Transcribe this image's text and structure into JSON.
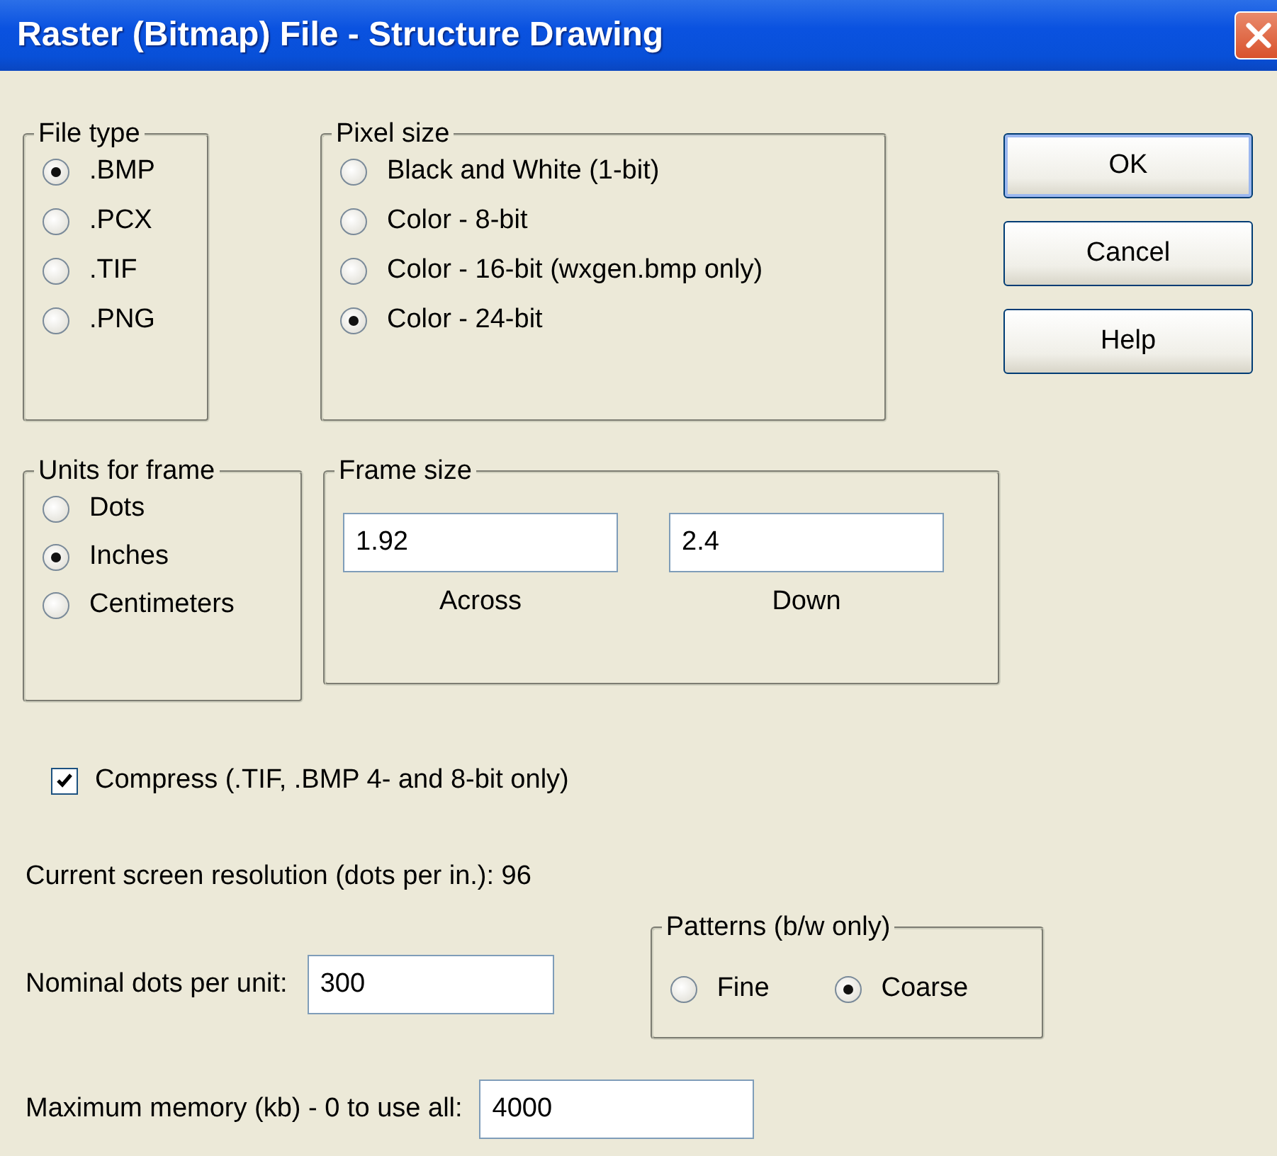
{
  "window": {
    "title": "Raster (Bitmap) File - Structure Drawing"
  },
  "file_type": {
    "label": "File type",
    "options": [
      {
        "label": ".BMP",
        "selected": true
      },
      {
        "label": ".PCX",
        "selected": false
      },
      {
        "label": ".TIF",
        "selected": false
      },
      {
        "label": ".PNG",
        "selected": false
      }
    ]
  },
  "pixel_size": {
    "label": "Pixel size",
    "options": [
      {
        "label": "Black and White (1-bit)",
        "selected": false
      },
      {
        "label": "Color - 8-bit",
        "selected": false
      },
      {
        "label": "Color - 16-bit (wxgen.bmp only)",
        "selected": false
      },
      {
        "label": "Color - 24-bit",
        "selected": true
      }
    ]
  },
  "buttons": [
    {
      "label": "OK",
      "default": true
    },
    {
      "label": "Cancel",
      "default": false
    },
    {
      "label": "Help",
      "default": false
    }
  ],
  "units_for_frame": {
    "label": "Units for frame",
    "options": [
      {
        "label": "Dots",
        "selected": false
      },
      {
        "label": "Inches",
        "selected": true
      },
      {
        "label": "Centimeters",
        "selected": false
      }
    ]
  },
  "frame_size": {
    "label": "Frame size",
    "fields": [
      {
        "value": "1.92",
        "caption": "Across"
      },
      {
        "value": "2.4",
        "caption": "Down"
      }
    ]
  },
  "compress": {
    "label": "Compress (.TIF, .BMP 4- and 8-bit only)",
    "checked": true
  },
  "resolution": "Current screen resolution (dots per in.): 96",
  "nominal": {
    "label": "Nominal dots per unit:",
    "value": "300"
  },
  "patterns": {
    "label": "Patterns (b/w only)",
    "options": [
      {
        "label": "Fine",
        "selected": false
      },
      {
        "label": "Coarse",
        "selected": true
      }
    ]
  },
  "memory": {
    "label": "Maximum memory (kb) - 0 to use all:",
    "value": "4000"
  }
}
